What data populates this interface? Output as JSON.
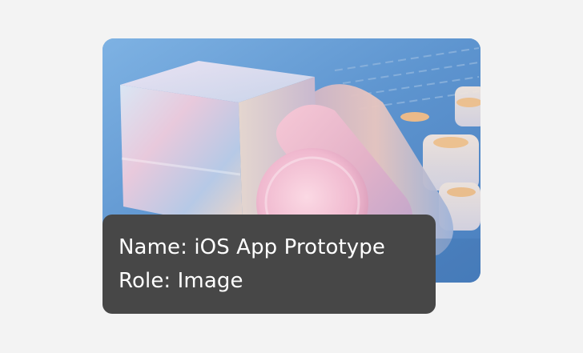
{
  "tooltip": {
    "name_line": "Name: iOS App Prototype",
    "role_line": "Role: Image"
  },
  "image": {
    "subject": "iOS App Prototype",
    "description": "3D render of translucent pastel glass shapes (cube and rounded pills) on a blue surface"
  },
  "colors": {
    "page_background": "#f3f3f3",
    "tooltip_background": "#474747",
    "tooltip_text": "#ffffff",
    "scene_blue": "#6fa2d6"
  }
}
